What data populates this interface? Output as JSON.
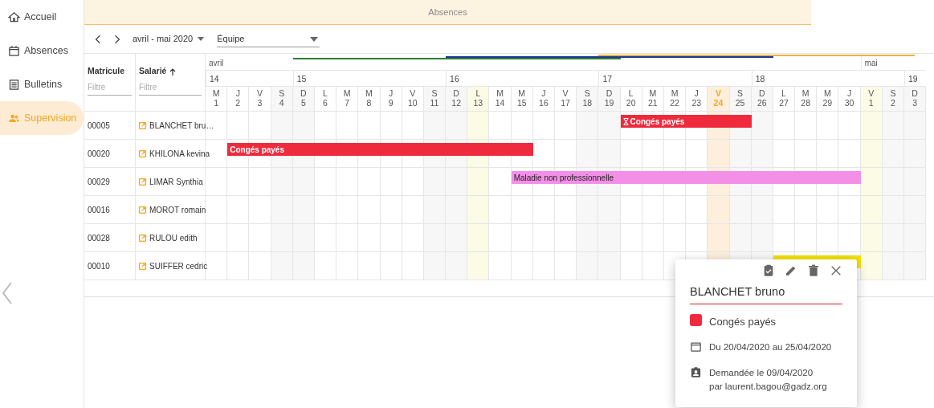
{
  "sidebar": {
    "items": [
      {
        "label": "Accueil",
        "selected": false
      },
      {
        "label": "Absences",
        "selected": false
      },
      {
        "label": "Bulletins",
        "selected": false
      },
      {
        "label": "Supervision",
        "selected": true
      }
    ]
  },
  "banner": {
    "title": "Absences"
  },
  "toolbar": {
    "period": "avril - mai 2020",
    "team": {
      "placeholder": "Équipe"
    }
  },
  "table": {
    "columns": [
      {
        "label": "Matricule",
        "filter": {
          "placeholder": "Filtre"
        }
      },
      {
        "label": "Salarié",
        "filter": {
          "placeholder": "Filtre"
        }
      }
    ],
    "weeks": [
      {
        "label": "14",
        "days": [
          {
            "month": "avril",
            "letter": "M",
            "num": "1",
            "kind": "weekday"
          },
          {
            "letter": "J",
            "num": "2",
            "kind": "weekday"
          },
          {
            "letter": "V",
            "num": "3",
            "kind": "weekday"
          },
          {
            "letter": "S",
            "num": "4",
            "kind": "weekend"
          }
        ]
      },
      {
        "label": "15",
        "days": [
          {
            "letter": "D",
            "num": "5",
            "kind": "weekend"
          },
          {
            "letter": "L",
            "num": "6",
            "kind": "weekday"
          },
          {
            "letter": "M",
            "num": "7",
            "kind": "weekday"
          },
          {
            "letter": "M",
            "num": "8",
            "kind": "weekday"
          },
          {
            "letter": "J",
            "num": "9",
            "kind": "weekday"
          },
          {
            "letter": "V",
            "num": "10",
            "kind": "weekday"
          },
          {
            "letter": "S",
            "num": "11",
            "kind": "weekend"
          }
        ]
      },
      {
        "label": "16",
        "days": [
          {
            "letter": "D",
            "num": "12",
            "kind": "weekend"
          },
          {
            "letter": "L",
            "num": "13",
            "kind": "holiday"
          },
          {
            "letter": "M",
            "num": "14",
            "kind": "weekday"
          },
          {
            "letter": "M",
            "num": "15",
            "kind": "weekday"
          },
          {
            "letter": "J",
            "num": "16",
            "kind": "weekday"
          },
          {
            "letter": "V",
            "num": "17",
            "kind": "weekday"
          },
          {
            "letter": "S",
            "num": "18",
            "kind": "weekend"
          }
        ]
      },
      {
        "label": "17",
        "days": [
          {
            "letter": "D",
            "num": "19",
            "kind": "weekend"
          },
          {
            "letter": "L",
            "num": "20",
            "kind": "weekday"
          },
          {
            "letter": "M",
            "num": "21",
            "kind": "weekday"
          },
          {
            "letter": "M",
            "num": "22",
            "kind": "weekday"
          },
          {
            "letter": "J",
            "num": "23",
            "kind": "weekday"
          },
          {
            "letter": "V",
            "num": "24",
            "kind": "today"
          },
          {
            "letter": "S",
            "num": "25",
            "kind": "weekend"
          }
        ]
      },
      {
        "label": "18",
        "days": [
          {
            "letter": "D",
            "num": "26",
            "kind": "weekend"
          },
          {
            "letter": "L",
            "num": "27",
            "kind": "weekday"
          },
          {
            "letter": "M",
            "num": "28",
            "kind": "weekday"
          },
          {
            "letter": "M",
            "num": "29",
            "kind": "weekday"
          },
          {
            "letter": "J",
            "num": "30",
            "kind": "weekday"
          },
          {
            "month": "mai",
            "letter": "V",
            "num": "1",
            "kind": "holiday"
          },
          {
            "letter": "S",
            "num": "2",
            "kind": "weekend"
          }
        ]
      },
      {
        "label": "19",
        "days": [
          {
            "letter": "D",
            "num": "3",
            "kind": "weekend"
          }
        ]
      }
    ],
    "period_lines": [
      {
        "color": "#2e7d32"
      },
      {
        "color": "#1a3a8f"
      },
      {
        "color": "#f0b040"
      }
    ],
    "rows": [
      {
        "id": "00005",
        "name": "BLANCHET bru…",
        "absences": [
          {
            "label": "Congés payés",
            "color": "#ee2a3c",
            "pending": true
          }
        ]
      },
      {
        "id": "00020",
        "name": "KHILONA kevina",
        "absences": [
          {
            "label": "Congés payés",
            "color": "#ee2a3c",
            "pending": false
          }
        ]
      },
      {
        "id": "00029",
        "name": "LIMAR Synthia",
        "absences": [
          {
            "label": "Maladie non professionnelle",
            "color": "#f48fe8",
            "pending": false
          }
        ]
      },
      {
        "id": "00016",
        "name": "MOROT romain"
      },
      {
        "id": "00028",
        "name": "RULOU edith"
      },
      {
        "id": "00010",
        "name": "SUIFFER cedric",
        "absences": [
          {
            "color": "#f5e10a",
            "pending": false
          }
        ]
      }
    ]
  },
  "popup": {
    "name": "BLANCHET bruno",
    "type": "Congés payés",
    "color": "#ee2a3c",
    "dates": "Du 20/04/2020 au 25/04/2020",
    "requested": "Demandée le 09/04/2020",
    "requested_by": "par laurent.bagou@gadz.org"
  }
}
